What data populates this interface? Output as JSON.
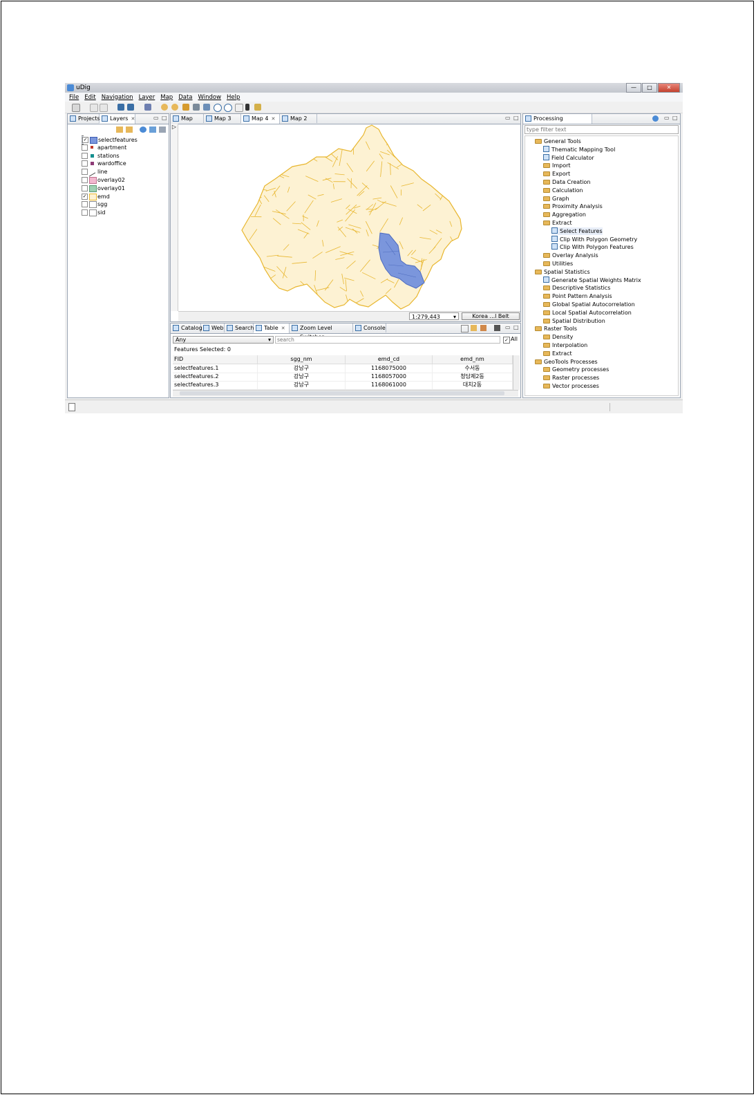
{
  "window": {
    "title": "uDig",
    "minimize": "—",
    "maximize": "□",
    "close": "✕"
  },
  "menu": [
    "File",
    "Edit",
    "Navigation",
    "Layer",
    "Map",
    "Data",
    "Window",
    "Help"
  ],
  "left_panel": {
    "tabs": [
      {
        "label": "Projects"
      },
      {
        "label": "Layers",
        "close": "✕"
      }
    ],
    "layers": [
      {
        "name": "selectfeatures",
        "checked": true,
        "icon": "polygon-blue-icon"
      },
      {
        "name": "apartment",
        "checked": false,
        "icon": "point-red-icon"
      },
      {
        "name": "stations",
        "checked": false,
        "icon": "point-teal-icon"
      },
      {
        "name": "wardoffice",
        "checked": false,
        "icon": "point-purple-icon"
      },
      {
        "name": "line",
        "checked": false,
        "icon": "line-icon"
      },
      {
        "name": "overlay02",
        "checked": false,
        "icon": "polygon-pink-icon"
      },
      {
        "name": "overlay01",
        "checked": false,
        "icon": "polygon-green-icon"
      },
      {
        "name": "emd",
        "checked": true,
        "icon": "polygon-yellow-icon"
      },
      {
        "name": "sgg",
        "checked": false,
        "icon": "polygon-white-icon"
      },
      {
        "name": "sid",
        "checked": false,
        "icon": "polygon-white-icon"
      }
    ],
    "check_mark": "✓"
  },
  "map_panel": {
    "tabs": [
      {
        "label": "Map"
      },
      {
        "label": "Map 3"
      },
      {
        "label": "Map 4",
        "active": true,
        "close": "✕"
      },
      {
        "label": "Map 2"
      }
    ],
    "scale": "1:279,443",
    "scale_arrow": "▾",
    "crs_button": "Korea ...l Belt",
    "palette_arrow": "▷",
    "colors": {
      "base_fill": "#fdf2d3",
      "base_stroke": "#e8b62e",
      "selected_fill": "#7b96dc",
      "selected_stroke": "#4d6bbf"
    }
  },
  "bottom_panel": {
    "tabs": [
      {
        "label": "Catalog"
      },
      {
        "label": "Web"
      },
      {
        "label": "Search"
      },
      {
        "label": "Table",
        "active": true,
        "close": "✕"
      },
      {
        "label": "Zoom Level Switcher"
      },
      {
        "label": "Console"
      }
    ],
    "filter_value": "Any",
    "search_placeholder": "search",
    "all_label": "All",
    "features_selected": "Features Selected: 0",
    "columns": [
      "FID",
      "sgg_nm",
      "emd_cd",
      "emd_nm"
    ],
    "rows": [
      [
        "selectfeatures.1",
        "강남구",
        "1168075000",
        "수서동"
      ],
      [
        "selectfeatures.2",
        "강남구",
        "1168057000",
        "청담제2동"
      ],
      [
        "selectfeatures.3",
        "강남구",
        "1168061000",
        "대치2동"
      ]
    ]
  },
  "right_panel": {
    "tab": "Processing Toolbox",
    "close": "✕",
    "filter_placeholder": "type filter text",
    "tree": [
      {
        "label": "General Tools",
        "level": 0,
        "type": "folder"
      },
      {
        "label": "Thematic Mapping Tool",
        "level": 1,
        "type": "tool"
      },
      {
        "label": "Field Calculator",
        "level": 1,
        "type": "tool"
      },
      {
        "label": "Import",
        "level": 1,
        "type": "folder"
      },
      {
        "label": "Export",
        "level": 1,
        "type": "folder"
      },
      {
        "label": "Data Creation",
        "level": 1,
        "type": "folder"
      },
      {
        "label": "Calculation",
        "level": 1,
        "type": "folder"
      },
      {
        "label": "Graph",
        "level": 1,
        "type": "folder"
      },
      {
        "label": "Proximity Analysis",
        "level": 1,
        "type": "folder"
      },
      {
        "label": "Aggregation",
        "level": 1,
        "type": "folder"
      },
      {
        "label": "Extract",
        "level": 1,
        "type": "folder"
      },
      {
        "label": "Select Features",
        "level": 2,
        "type": "tool",
        "highlight": true
      },
      {
        "label": "Clip With Polygon Geometry",
        "level": 2,
        "type": "tool"
      },
      {
        "label": "Clip With Polygon Features",
        "level": 2,
        "type": "tool"
      },
      {
        "label": "Overlay Analysis",
        "level": 1,
        "type": "folder"
      },
      {
        "label": "Utilities",
        "level": 1,
        "type": "folder"
      },
      {
        "label": "Spatial Statistics",
        "level": 0,
        "type": "folder"
      },
      {
        "label": "Generate Spatial Weights Matrix",
        "level": 1,
        "type": "tool"
      },
      {
        "label": "Descriptive Statistics",
        "level": 1,
        "type": "folder"
      },
      {
        "label": "Point Pattern Analysis",
        "level": 1,
        "type": "folder"
      },
      {
        "label": "Global Spatial Autocorrelation",
        "level": 1,
        "type": "folder"
      },
      {
        "label": "Local Spatial Autocorrelation",
        "level": 1,
        "type": "folder"
      },
      {
        "label": "Spatial Distribution",
        "level": 1,
        "type": "folder"
      },
      {
        "label": "Raster Tools",
        "level": 0,
        "type": "folder"
      },
      {
        "label": "Density",
        "level": 1,
        "type": "folder"
      },
      {
        "label": "Interpolation",
        "level": 1,
        "type": "folder"
      },
      {
        "label": "Extract",
        "level": 1,
        "type": "folder"
      },
      {
        "label": "GeoTools Processes",
        "level": 0,
        "type": "folder"
      },
      {
        "label": "Geometry processes",
        "level": 1,
        "type": "folder"
      },
      {
        "label": "Raster processes",
        "level": 1,
        "type": "folder"
      },
      {
        "label": "Vector processes",
        "level": 1,
        "type": "folder"
      }
    ]
  },
  "status_bar": {
    "icon": "new-item-icon"
  }
}
